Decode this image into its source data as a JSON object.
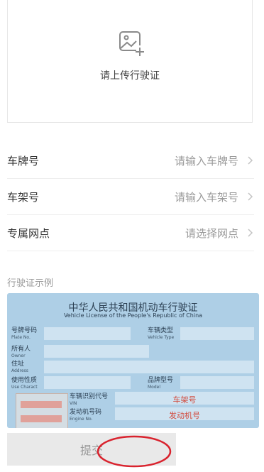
{
  "upload": {
    "text": "请上传行驶证",
    "icon": "add-image-icon"
  },
  "form": {
    "rows": [
      {
        "label": "车牌号",
        "placeholder": "请输入车牌号"
      },
      {
        "label": "车架号",
        "placeholder": "请输入车架号"
      },
      {
        "label": "专属网点",
        "placeholder": "请选择网点"
      }
    ]
  },
  "sample": {
    "title": "行驶证示例",
    "license": {
      "title": "中华人民共和国机动车行驶证",
      "subtitle": "Vehicle License of the People's Republic of China",
      "fields": {
        "plate": {
          "cn": "号牌号码",
          "en": "Plate No."
        },
        "vehicle_type": {
          "cn": "车辆类型",
          "en": "Vehicle Type"
        },
        "owner": {
          "cn": "所有人",
          "en": "Owner"
        },
        "address": {
          "cn": "住址",
          "en": "Address"
        },
        "use_character": {
          "cn": "使用性质",
          "en": "Use Charact"
        },
        "model": {
          "cn": "品牌型号",
          "en": "Model"
        },
        "vin": {
          "cn": "车辆识别代号",
          "en": "VIN"
        },
        "engine": {
          "cn": "发动机号码",
          "en": "Engine No."
        }
      },
      "vin_value": "车架号",
      "engine_value": "发动机号"
    }
  },
  "submit": {
    "label": "提交"
  },
  "colors": {
    "license_bg": "#aecfe6",
    "highlight_red": "#d24a3c",
    "annotation_circle": "#d9232e"
  }
}
